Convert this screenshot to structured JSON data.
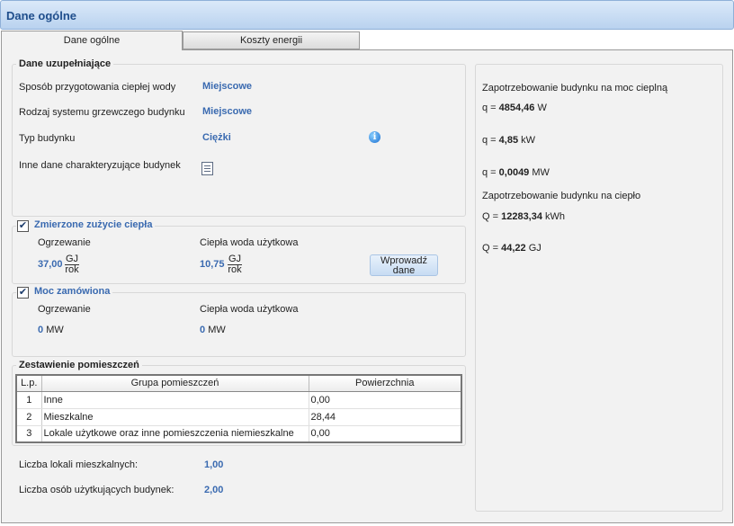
{
  "window": {
    "title": "Dane ogólne"
  },
  "tabs": [
    {
      "label": "Dane ogólne",
      "active": true
    },
    {
      "label": "Koszty energii",
      "active": false
    }
  ],
  "supplementary": {
    "title": "Dane uzupełniające",
    "rows": [
      {
        "label": "Sposób przygotowania ciepłej wody",
        "value": "Miejscowe"
      },
      {
        "label": "Rodzaj systemu grzewczego budynku",
        "value": "Miejscowe"
      },
      {
        "label": "Typ budynku",
        "value": "Ciężki"
      },
      {
        "label": "Inne dane charakteryzujące budynek",
        "value": ""
      }
    ]
  },
  "measured": {
    "title": "Zmierzone zużycie ciepła",
    "checked": true,
    "heating_label": "Ogrzewanie",
    "heating_value": "37,00",
    "hot_water_label": "Ciepła woda użytkowa",
    "hot_water_value": "10,75",
    "unit_top": "GJ",
    "unit_bottom": "rok",
    "button_label_1": "Wprowadź",
    "button_label_2": "dane"
  },
  "ordered_power": {
    "title": "Moc zamówiona",
    "checked": true,
    "heating_label": "Ogrzewanie",
    "heating_value": "0",
    "hot_water_label": "Ciepła woda użytkowa",
    "hot_water_value": "0",
    "unit": "MW"
  },
  "rooms": {
    "title": "Zestawienie pomieszczeń",
    "headers": [
      "L.p.",
      "Grupa pomieszczeń",
      "Powierzchnia"
    ],
    "rows": [
      {
        "lp": "1",
        "group": "Inne",
        "area": "0,00"
      },
      {
        "lp": "2",
        "group": "Mieszkalne",
        "area": "28,44"
      },
      {
        "lp": "3",
        "group": "Lokale użytkowe oraz inne pomieszczenia niemieszkalne",
        "area": "0,00"
      }
    ]
  },
  "counts": {
    "dwellings_label": "Liczba lokali mieszkalnych:",
    "dwellings_value": "1,00",
    "persons_label": "Liczba osób użytkujących budynek:",
    "persons_value": "2,00"
  },
  "demand": {
    "power_title": "Zapotrzebowanie budynku na moc cieplną",
    "q_w_prefix": "q = ",
    "q_w_value": "4854,46",
    "q_w_unit": "W",
    "q_kw_prefix": "q = ",
    "q_kw_value": "4,85",
    "q_kw_unit": "kW",
    "q_mw_prefix": "q = ",
    "q_mw_value": "0,0049",
    "q_mw_unit": "MW",
    "heat_title": "Zapotrzebowanie budynku na ciepło",
    "Q_kwh_prefix": "Q = ",
    "Q_kwh_value": "12283,34",
    "Q_kwh_unit": "kWh",
    "Q_gj_prefix": "Q = ",
    "Q_gj_value": "44,22",
    "Q_gj_unit": "GJ"
  },
  "colors": {
    "accent": "#3a6ab0",
    "title_text": "#1f4e8c"
  }
}
